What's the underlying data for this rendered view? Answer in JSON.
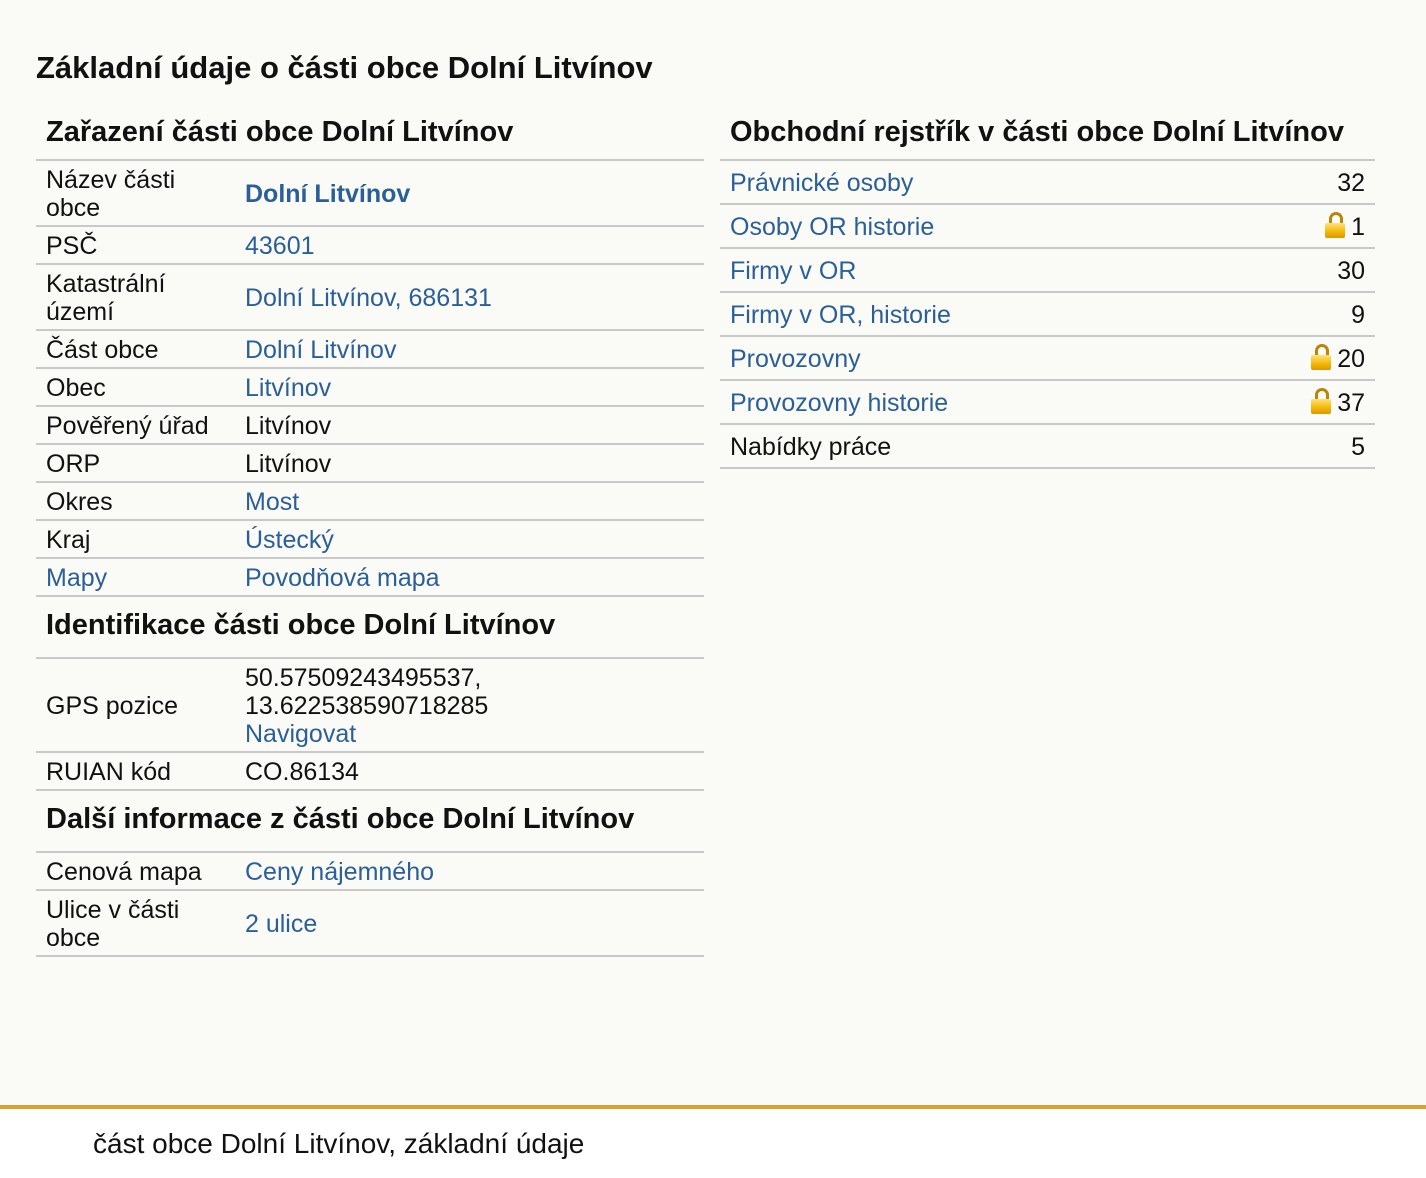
{
  "page": {
    "title": "Základní údaje o části obce Dolní Litvínov"
  },
  "classification": {
    "title": "Zařazení části obce Dolní Litvínov",
    "rows": [
      {
        "label": "Název části obce",
        "value": "Dolní Litvínov"
      },
      {
        "label": "PSČ",
        "value": "43601"
      },
      {
        "label": "Katastrální území",
        "value": "Dolní Litvínov, 686131"
      },
      {
        "label": "Část obce",
        "value": "Dolní Litvínov"
      },
      {
        "label": "Obec",
        "value": "Litvínov"
      },
      {
        "label": "Pověřený úřad",
        "value": "Litvínov"
      },
      {
        "label": "ORP",
        "value": "Litvínov"
      },
      {
        "label": "Okres",
        "value": "Most"
      },
      {
        "label": "Kraj",
        "value": "Ústecký"
      },
      {
        "label": "Mapy",
        "value": "Povodňová mapa"
      }
    ]
  },
  "identification": {
    "title": "Identifikace části obce Dolní Litvínov",
    "gps_label": "GPS pozice",
    "gps_lat": "50.57509243495537,",
    "gps_lon": "13.622538590718285",
    "navigate_label": "Navigovat",
    "ruian_label": "RUIAN kód",
    "ruian_value": "CO.86134"
  },
  "more_info": {
    "title": "Další informace z části obce Dolní Litvínov",
    "price_map_label": "Cenová mapa",
    "price_map_value": "Ceny nájemného",
    "streets_label": "Ulice v části obce",
    "streets_value": "2 ulice"
  },
  "trade_register": {
    "title": "Obchodní rejstřík v části obce Dolní Litvínov",
    "rows": [
      {
        "label": "Právnické osoby",
        "count": "32",
        "locked": false
      },
      {
        "label": "Osoby OR historie",
        "count": "1",
        "locked": true
      },
      {
        "label": "Firmy v OR",
        "count": "30",
        "locked": false
      },
      {
        "label": "Firmy v OR, historie",
        "count": "9",
        "locked": false
      },
      {
        "label": "Provozovny",
        "count": "20",
        "locked": true
      },
      {
        "label": "Provozovny historie",
        "count": "37",
        "locked": true
      },
      {
        "label": "Nabídky práce",
        "count": "5",
        "locked": false
      }
    ]
  },
  "footer": {
    "text": "část obce Dolní Litvínov, základní údaje",
    "accent_color": "#d9a230"
  },
  "colors": {
    "link": "#2b5f97",
    "background": "#fafaf7",
    "lock": "#f2b705"
  },
  "icons": {
    "lock": "lock-icon"
  }
}
